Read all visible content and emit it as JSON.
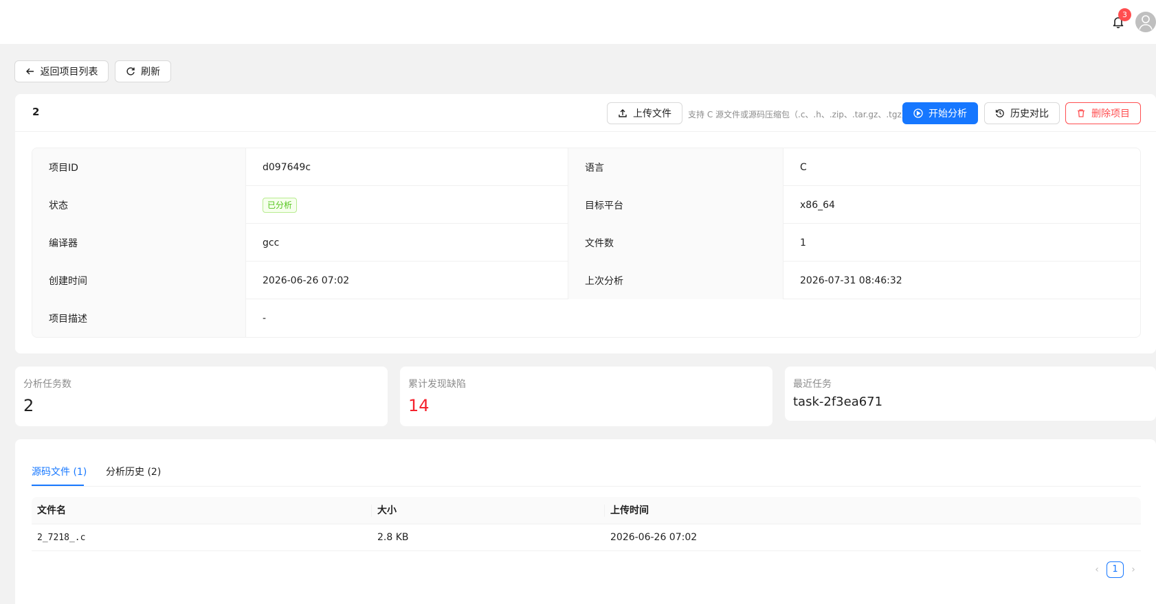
{
  "header": {
    "notification_count": "3"
  },
  "toolbar": {
    "back_label": "返回项目列表",
    "refresh_label": "刷新"
  },
  "project": {
    "title": "2",
    "upload_label": "上传文件",
    "upload_hint": "支持 C 源文件或源码压缩包（.c、.h、.zip、.tar.gz、.tgz）",
    "start_label": "开始分析",
    "history_label": "历史对比",
    "delete_label": "删除项目"
  },
  "details": {
    "id_label": "项目ID",
    "id_value": "d097649c",
    "lang_label": "语言",
    "lang_value": "C",
    "status_label": "状态",
    "status_value": "已分析",
    "platform_label": "目标平台",
    "platform_value": "x86_64",
    "compiler_label": "编译器",
    "compiler_value": "gcc",
    "files_label": "文件数",
    "files_value": "1",
    "created_label": "创建时间",
    "created_value": "2026-06-26 07:02",
    "last_label": "上次分析",
    "last_value": "2026-07-31 08:46:32",
    "desc_label": "项目描述",
    "desc_value": "-"
  },
  "stats": {
    "tasks_title": "分析任务数",
    "tasks_value": "2",
    "defects_title": "累计发现缺陷",
    "defects_value": "14",
    "recent_title": "最近任务",
    "recent_value": "task-2f3ea671"
  },
  "tabs": [
    {
      "label": "源码文件 (1)",
      "active": true
    },
    {
      "label": "分析历史 (2)",
      "active": false
    }
  ],
  "table": {
    "columns": [
      "文件名",
      "大小",
      "上传时间"
    ],
    "rows": [
      [
        "2_7218_.c",
        "2.8 KB",
        "2026-06-26 07:02"
      ]
    ]
  },
  "pagination": {
    "current": "1"
  },
  "colors": {
    "primary": "#1677ff",
    "danger": "#ff4d4f",
    "success": "#52c41a",
    "defect": "#f5222d"
  }
}
